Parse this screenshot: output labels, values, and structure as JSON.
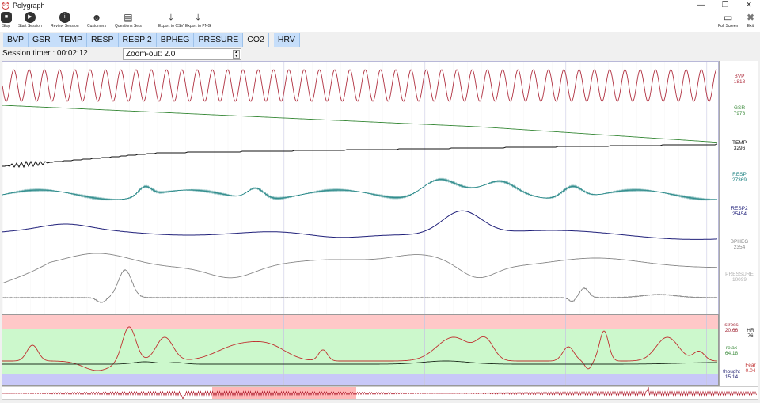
{
  "window": {
    "title": "Polygraph",
    "minimize": "—",
    "restore": "❐",
    "close": "✕"
  },
  "toolbar": [
    {
      "label": "Stop",
      "icon": "stop-icon"
    },
    {
      "label": "Start Session",
      "icon": "play-icon"
    },
    {
      "label": "Review Session",
      "icon": "info-icon"
    },
    {
      "label": "Customers",
      "icon": "users-icon"
    },
    {
      "label": "Questions Sets",
      "icon": "clipboard-icon"
    },
    {
      "label": "Export to CSV",
      "icon": "export-csv-icon"
    },
    {
      "label": "Export to PNG",
      "icon": "export-png-icon"
    }
  ],
  "toolbar_right": [
    {
      "label": "Full Screen",
      "icon": "fullscreen-icon"
    },
    {
      "label": "Exit",
      "icon": "exit-icon"
    }
  ],
  "tabs": [
    "BVP",
    "GSR",
    "TEMP",
    "RESP",
    "RESP 2",
    "BPHEG",
    "PRESURE",
    "CO2",
    "HRV"
  ],
  "session_timer": "Session timer : 00:02:12",
  "zoom_value": "Zoom-out: 2.0",
  "channels": [
    {
      "name": "BVP",
      "value": "1818",
      "color": "#b03040"
    },
    {
      "name": "GSR",
      "value": "7978",
      "color": "#3a8a3a"
    },
    {
      "name": "TEMP",
      "value": "3296",
      "color": "#111111"
    },
    {
      "name": "RESP",
      "value": "27369",
      "color": "#1a8080"
    },
    {
      "name": "RESP2",
      "value": "25454",
      "color": "#20207a"
    },
    {
      "name": "BPHEG",
      "value": "2354",
      "color": "#888888"
    },
    {
      "name": "PRESSURE",
      "value": "10099",
      "color": "#b0b0b0"
    }
  ],
  "emotion": {
    "stress_label": "stress",
    "stress": "20.66",
    "hr_label": "HR",
    "hr": "76",
    "relax_label": "relax",
    "relax": "64.18",
    "fear_label": "Fear",
    "fear": "0.04",
    "thought_label": "thought",
    "thought": "15.14"
  }
}
